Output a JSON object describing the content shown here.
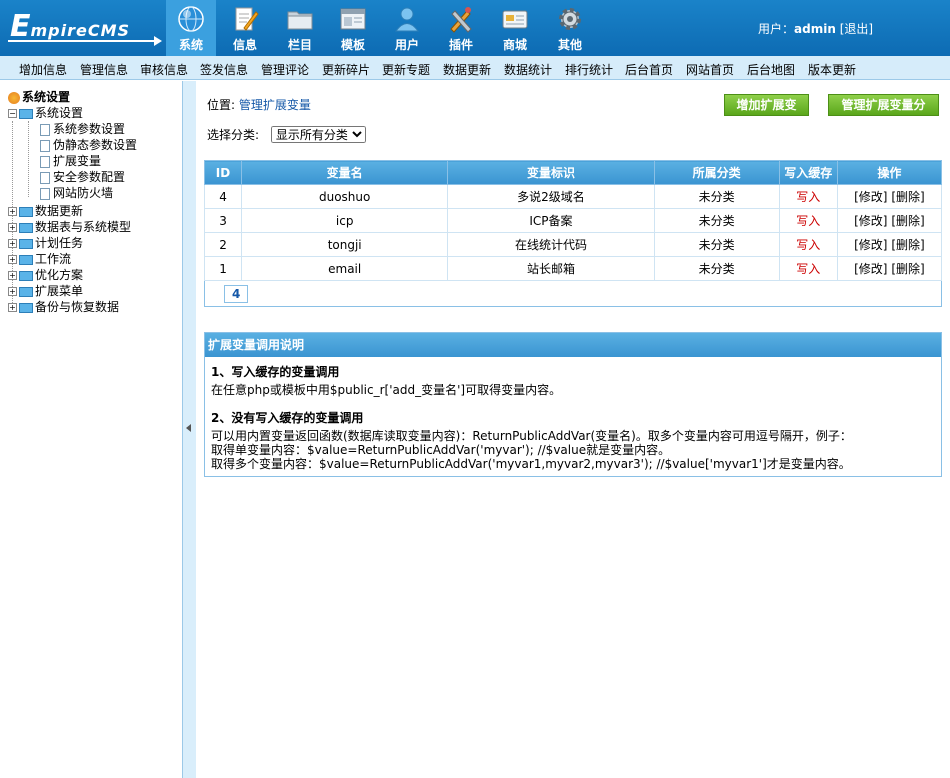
{
  "header": {
    "logo_big": "E",
    "logo_small": "mpireCMS",
    "nav": [
      {
        "label": "系统",
        "icon": "globe-icon",
        "active": true
      },
      {
        "label": "信息",
        "icon": "edit-icon"
      },
      {
        "label": "栏目",
        "icon": "folder-icon"
      },
      {
        "label": "模板",
        "icon": "window-icon"
      },
      {
        "label": "用户",
        "icon": "user-icon"
      },
      {
        "label": "插件",
        "icon": "tools-icon"
      },
      {
        "label": "商城",
        "icon": "card-icon"
      },
      {
        "label": "其他",
        "icon": "gear-icon"
      }
    ],
    "user_prefix": "用户：",
    "username": "admin",
    "logout": "[退出]"
  },
  "submenu": [
    "增加信息",
    "管理信息",
    "审核信息",
    "签发信息",
    "管理评论",
    "更新碎片",
    "更新专题",
    "数据更新",
    "数据统计",
    "排行统计",
    "后台首页",
    "网站首页",
    "后台地图",
    "版本更新"
  ],
  "sidebar": {
    "root": "系统设置",
    "open_group": "系统设置",
    "open_items": [
      "系统参数设置",
      "伪静态参数设置",
      "扩展变量",
      "安全参数配置",
      "网站防火墙"
    ],
    "groups": [
      "数据更新",
      "数据表与系统模型",
      "计划任务",
      "工作流",
      "优化方案",
      "扩展菜单",
      "备份与恢复数据"
    ]
  },
  "main": {
    "location_prefix": "位置:",
    "location_link": "管理扩展变量",
    "btn_add": "增加扩展变量",
    "btn_manage": "管理扩展变量分类",
    "filter_label": "选择分类:",
    "filter_selected": "显示所有分类",
    "table": {
      "headers": [
        "ID",
        "变量名",
        "变量标识",
        "所属分类",
        "写入缓存",
        "操作"
      ],
      "rows": [
        {
          "id": "4",
          "name": "duoshuo",
          "label": "多说2级域名",
          "category": "未分类",
          "write": "写入",
          "edit": "[修改]",
          "del": "[删除]"
        },
        {
          "id": "3",
          "name": "icp",
          "label": "ICP备案",
          "category": "未分类",
          "write": "写入",
          "edit": "[修改]",
          "del": "[删除]"
        },
        {
          "id": "2",
          "name": "tongji",
          "label": "在线统计代码",
          "category": "未分类",
          "write": "写入",
          "edit": "[修改]",
          "del": "[删除]"
        },
        {
          "id": "1",
          "name": "email",
          "label": "站长邮箱",
          "category": "未分类",
          "write": "写入",
          "edit": "[修改]",
          "del": "[删除]"
        }
      ],
      "page": "4"
    },
    "help": {
      "title": "扩展变量调用说明",
      "sec1": "1、写入缓存的变量调用",
      "sec1_text": "在任意php或模板中用$public_r['add_变量名']可取得变量内容。",
      "sec2": "2、没有写入缓存的变量调用",
      "sec2_line1": "可以用内置变量返回函数(数据库读取变量内容)：ReturnPublicAddVar(变量名)。取多个变量内容可用逗号隔开，例子：",
      "sec2_line2": "取得单变量内容：$value=ReturnPublicAddVar('myvar'); //$value就是变量内容。",
      "sec2_line3": "取得多个变量内容：$value=ReturnPublicAddVar('myvar1,myvar2,myvar3'); //$value['myvar1']才是变量内容。"
    }
  }
}
